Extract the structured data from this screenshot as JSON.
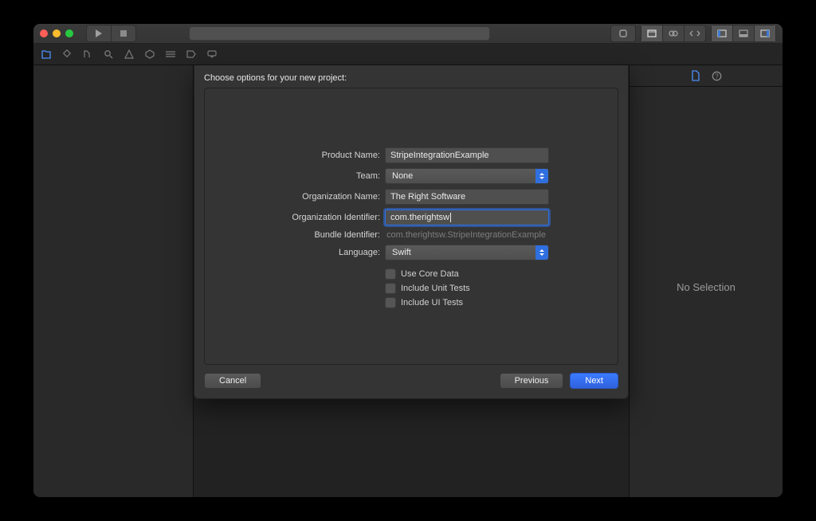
{
  "sheet": {
    "title": "Choose options for your new project:",
    "labels": {
      "product_name": "Product Name:",
      "team": "Team:",
      "org_name": "Organization Name:",
      "org_id": "Organization Identifier:",
      "bundle_id": "Bundle Identifier:",
      "language": "Language:"
    },
    "values": {
      "product_name": "StripeIntegrationExample",
      "team": "None",
      "org_name": "The Right Software",
      "org_id": "com.therightsw",
      "bundle_id": "com.therightsw.StripeIntegrationExample",
      "language": "Swift"
    },
    "checkboxes": {
      "core_data": "Use Core Data",
      "unit_tests": "Include Unit Tests",
      "ui_tests": "Include UI Tests"
    },
    "buttons": {
      "cancel": "Cancel",
      "previous": "Previous",
      "next": "Next"
    }
  },
  "inspector": {
    "no_selection": "No Selection"
  }
}
